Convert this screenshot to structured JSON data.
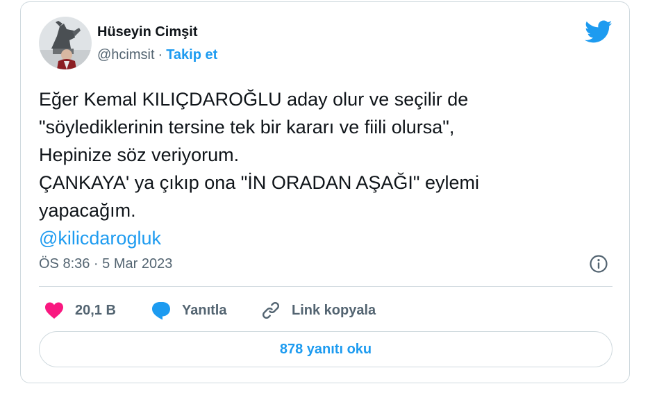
{
  "author": {
    "name": "Hüseyin Cimşit",
    "handle": "@hcimsit",
    "separator": "·",
    "follow_label": "Takip et"
  },
  "tweet": {
    "lines": [
      "Eğer Kemal KILIÇDAROĞLU aday olur ve seçilir de",
      "\"söylediklerinin tersine tek bir kararı ve fiili olursa\",",
      "Hepinize söz veriyorum.",
      "ÇANKAYA' ya çıkıp ona \"İN ORADAN AŞAĞI\" eylemi",
      "yapacağım."
    ],
    "mention": "@kilicdarogluk",
    "timestamp": "ÖS 8:36 · 5 Mar 2023"
  },
  "actions": {
    "like_count": "20,1 B",
    "reply_label": "Yanıtla",
    "copy_link_label": "Link kopyala"
  },
  "read_replies_label": "878 yanıtı oku",
  "icons": {
    "brand": "twitter-bird-icon",
    "info": "info-icon",
    "like": "heart-icon",
    "reply": "speech-bubble-icon",
    "copy": "link-icon"
  },
  "colors": {
    "accent": "#1d9bf0",
    "like": "#f91880",
    "text": "#0f1419",
    "secondary_text": "#536471",
    "border": "#cfd9de"
  }
}
